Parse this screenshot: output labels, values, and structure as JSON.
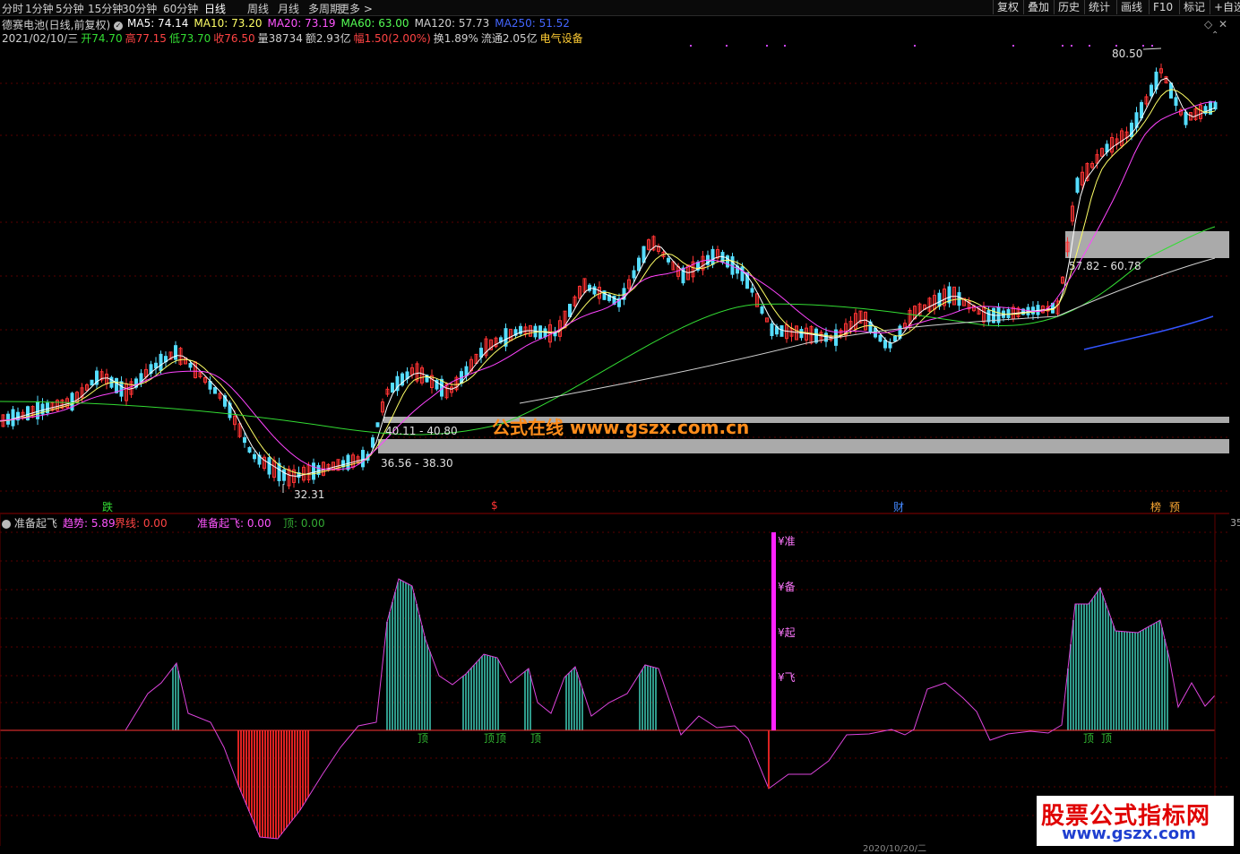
{
  "toolbar": {
    "periods": [
      "分时",
      "1分钟",
      "5分钟",
      "15分钟",
      "30分钟",
      "60分钟",
      "日线",
      "周线",
      "月线",
      "多周期",
      "更多 >"
    ],
    "active_period": "日线",
    "right_buttons": [
      "复权",
      "叠加",
      "历史",
      "统计",
      "画线",
      "F10",
      "标记",
      "+自选"
    ]
  },
  "header": {
    "stock_name": "德赛电池(日线,前复权)",
    "ma": [
      {
        "label": "MA5: 74.14",
        "color": "#ffffff"
      },
      {
        "label": "MA10: 73.20",
        "color": "#ffff66"
      },
      {
        "label": "MA20: 73.19",
        "color": "#ff55ff"
      },
      {
        "label": "MA60: 63.00",
        "color": "#55ff55"
      },
      {
        "label": "MA120: 57.73",
        "color": "#d0d0d0"
      },
      {
        "label": "MA250: 51.52",
        "color": "#4466ff"
      }
    ],
    "quote": [
      {
        "text": "2021/02/10/三",
        "color": "#d0d0d0"
      },
      {
        "text": "开74.70",
        "color": "#33dd33"
      },
      {
        "text": "高77.15",
        "color": "#ff4444"
      },
      {
        "text": "低73.70",
        "color": "#33dd33"
      },
      {
        "text": "收76.50",
        "color": "#ff4444"
      },
      {
        "text": "量38734",
        "color": "#d0d0d0"
      },
      {
        "text": "额2.93亿",
        "color": "#d0d0d0"
      },
      {
        "text": "幅1.50(2.00%)",
        "color": "#ff4444"
      },
      {
        "text": "换1.89%",
        "color": "#d0d0d0"
      },
      {
        "text": "流通2.05亿",
        "color": "#d0d0d0"
      },
      {
        "text": "电气设备",
        "color": "#ffcc33"
      }
    ]
  },
  "price_labels": {
    "high": "80.50",
    "low": "32.31",
    "zone1": "57.82 - 60.78",
    "zone2": "40.11 - 40.80",
    "zone3": "36.56 - 38.30"
  },
  "event_markers": [
    {
      "text": "跌",
      "color": "#33dd33"
    },
    {
      "text": "$",
      "color": "#ff3333"
    },
    {
      "text": "财",
      "color": "#4488ff"
    },
    {
      "text": "榜",
      "color": "#ffaa33"
    },
    {
      "text": "预",
      "color": "#ffaa33"
    }
  ],
  "watermark": "公式在线  www.gszx.com.cn",
  "sub_header": {
    "name": "准备起飞",
    "items": [
      {
        "label": "趋势: 5.89",
        "color": "#ff55ff"
      },
      {
        "label": "界线: 0.00",
        "color": "#ff4444"
      },
      {
        "label": "准备起飞: 0.00",
        "color": "#ff55ff"
      },
      {
        "label": "顶: 0.00",
        "color": "#33aa33"
      }
    ]
  },
  "signal_labels": [
    "¥准",
    "¥备",
    "¥起",
    "¥飞"
  ],
  "top_marks": [
    "顶",
    "顶",
    "顶",
    "顶",
    "顶",
    "顶"
  ],
  "right_axis": "35",
  "bottom_date": "2020/10/20/二",
  "logo": {
    "title": "股票公式指标网",
    "url": "www.gszx.com"
  },
  "colors": {
    "up": "#ff3333",
    "down": "#55ddff",
    "ma5": "#ffffff",
    "ma10": "#ffff66",
    "ma20": "#ff44ff",
    "ma60": "#33dd33",
    "ma120": "#d0d0d0",
    "ma250": "#3355ff"
  }
}
